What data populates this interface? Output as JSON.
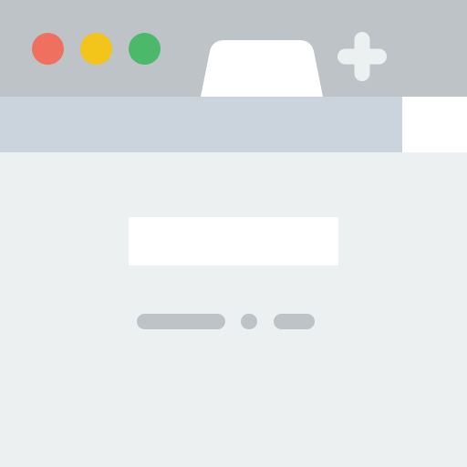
{
  "colors": {
    "titlebar": "#BEC3C8",
    "addressbar": "#CBD4DC",
    "addressbar_end": "#FFFFFF",
    "content": "#ECF0F1",
    "tab": "#FFFFFF",
    "new_tab_icon": "#ECF0F1",
    "close_button": "#F0705F",
    "minimize_button": "#F3C41A",
    "zoom_button": "#4CB96A",
    "search_box": "#FFFFFF",
    "placeholder_lines": "#BEC3C8"
  },
  "icons": {
    "close": "close-circle",
    "minimize": "minimize-circle",
    "zoom": "zoom-circle",
    "new_tab": "plus-icon"
  }
}
